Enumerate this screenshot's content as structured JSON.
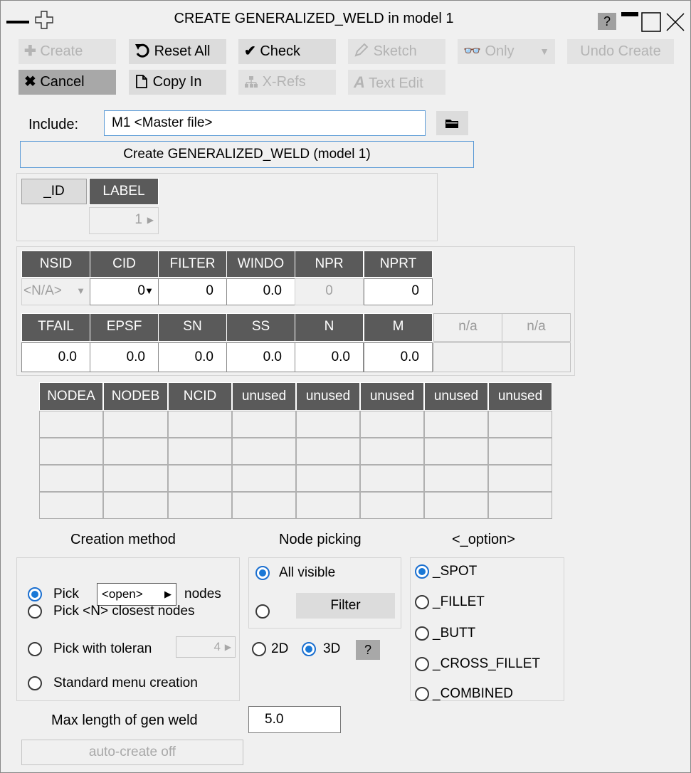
{
  "window": {
    "title": "CREATE GENERALIZED_WELD in model 1",
    "help": "?"
  },
  "toolbar": {
    "create": "Create",
    "reset_all": "Reset All",
    "check": "Check",
    "sketch": "Sketch",
    "only": "Only",
    "undo_create": "Undo Create",
    "cancel": "Cancel",
    "copy_in": "Copy In",
    "xrefs": "X-Refs",
    "text_edit": "Text Edit"
  },
  "include": {
    "label": "Include:",
    "value": "M1  <Master file>"
  },
  "create_banner": "Create GENERALIZED_WELD (model 1)",
  "id_panel": {
    "id_btn": "_ID",
    "label_hdr": "LABEL",
    "label_value": "1"
  },
  "card1": {
    "headers": [
      "NSID",
      "CID",
      "FILTER",
      "WINDO",
      "NPR",
      "NPRT"
    ],
    "values": [
      "<N/A>",
      "0",
      "0",
      "0.0",
      "0",
      "0"
    ]
  },
  "card2": {
    "headers": [
      "TFAIL",
      "EPSF",
      "SN",
      "SS",
      "N",
      "M",
      "n/a",
      "n/a"
    ],
    "values": [
      "0.0",
      "0.0",
      "0.0",
      "0.0",
      "0.0",
      "0.0",
      "",
      ""
    ]
  },
  "node_table": {
    "headers": [
      "NODEA",
      "NODEB",
      "NCID",
      "unused",
      "unused",
      "unused",
      "unused",
      "unused"
    ]
  },
  "creation_method": {
    "title": "Creation method",
    "pick": "Pick",
    "pick_dropdown": "<open>",
    "pick_suffix": "nodes",
    "pick_n": "Pick <N> closest nodes",
    "pick_tol": "Pick with toleran",
    "tol_value": "4",
    "standard": "Standard menu creation"
  },
  "node_picking": {
    "title": "Node picking",
    "all_visible": "All visible",
    "filter": "Filter",
    "d2": "2D",
    "d3": "3D",
    "help": "?"
  },
  "option": {
    "title": "<_option>",
    "items": [
      "_SPOT",
      "_FILLET",
      "_BUTT",
      "_CROSS_FILLET",
      "_COMBINED"
    ]
  },
  "max_length": {
    "label": "Max length of gen weld",
    "value": "5.0"
  },
  "auto_create": "auto-create off"
}
